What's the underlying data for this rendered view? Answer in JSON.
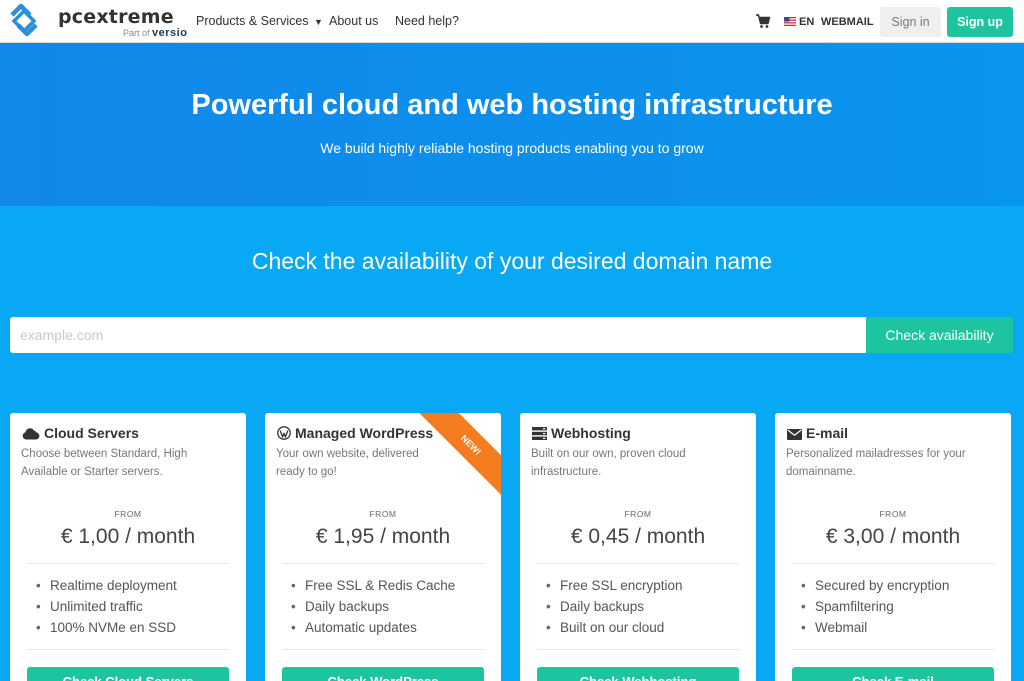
{
  "header": {
    "brand": "pcextreme",
    "brand_sub_prefix": "Part of",
    "brand_sub": "versio",
    "nav": [
      "Products & Services",
      "About us",
      "Need help?"
    ],
    "lang": "EN",
    "webmail": "WEBMAIL",
    "signin": "Sign in",
    "signup": "Sign up",
    "colors": {
      "accent": "#1ec3a0",
      "logo": "#2a8fd6"
    }
  },
  "hero": {
    "title": "Powerful cloud and web hosting infrastructure",
    "subtitle": "We build highly reliable hosting products enabling you to grow"
  },
  "domain": {
    "title": "Check the availability of your desired domain name",
    "placeholder": "example.com",
    "button": "Check availability"
  },
  "cards": [
    {
      "icon": "cloud-icon",
      "title": "Cloud Servers",
      "description": "Choose between Standard, High Available or Starter servers.",
      "from": "FROM",
      "price": "€ 1,00",
      "period": "/ month",
      "features": [
        "Realtime deployment",
        "Unlimited traffic",
        "100% NVMe en SSD"
      ],
      "button": "Check Cloud Servers"
    },
    {
      "icon": "wordpress-icon",
      "title": "Managed WordPress",
      "description": "Your own website, delivered ready to go!",
      "badge": "NEW!",
      "from": "FROM",
      "price": "€ 1,95",
      "period": "/ month",
      "features": [
        "Free SSL & Redis Cache",
        "Daily backups",
        "Automatic updates"
      ],
      "button": "Check WordPress"
    },
    {
      "icon": "server-icon",
      "title": "Webhosting",
      "description": "Built on our own, proven cloud infrastructure.",
      "from": "FROM",
      "price": "€ 0,45",
      "period": "/ month",
      "features": [
        "Free SSL encryption",
        "Daily backups",
        "Built on our cloud"
      ],
      "button": "Check Webhosting"
    },
    {
      "icon": "envelope-icon",
      "title": "E-mail",
      "description": "Personalized mailadresses for your domainname.",
      "from": "FROM",
      "price": "€ 3,00",
      "period": "/ month",
      "features": [
        "Secured by encryption",
        "Spamfiltering",
        "Webmail"
      ],
      "button": "Check E-mail"
    }
  ]
}
